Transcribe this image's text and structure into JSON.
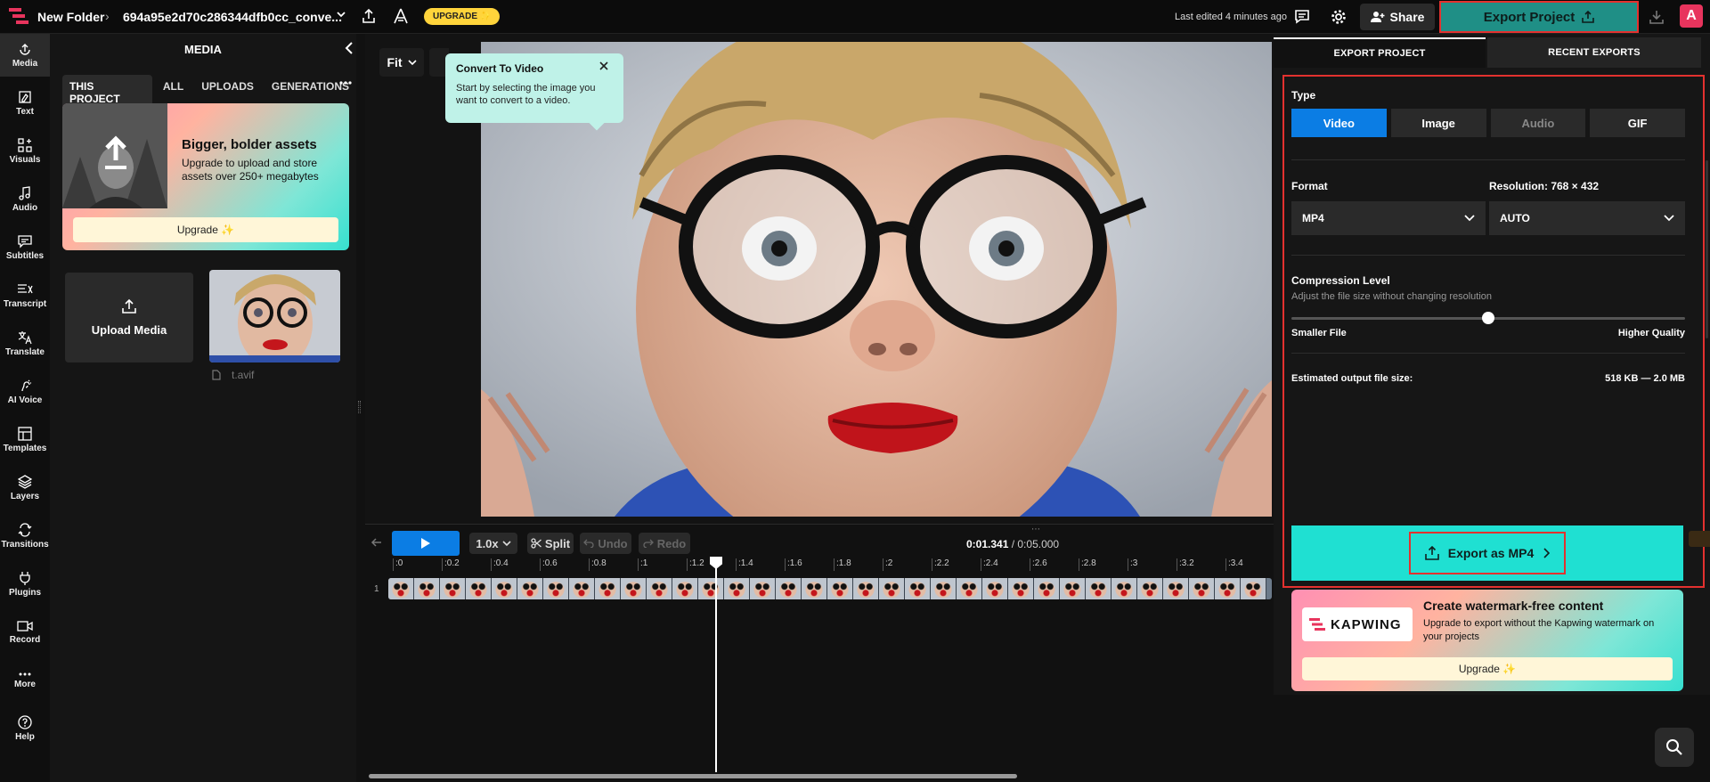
{
  "topbar": {
    "folder": "New Folder",
    "project_name": "694a95e2d70c286344dfb0cc_conve...",
    "upgrade_label": "UPGRADE ✨",
    "last_edited": "Last edited 4 minutes ago",
    "share_label": "Share",
    "export_label": "Export Project",
    "avatar_letter": "A"
  },
  "rail": [
    {
      "label": "Media",
      "icon": "media-icon"
    },
    {
      "label": "Text",
      "icon": "text-icon"
    },
    {
      "label": "Visuals",
      "icon": "visuals-icon"
    },
    {
      "label": "Audio",
      "icon": "audio-icon"
    },
    {
      "label": "Subtitles",
      "icon": "subtitles-icon"
    },
    {
      "label": "Transcript",
      "icon": "transcript-icon"
    },
    {
      "label": "Translate",
      "icon": "translate-icon"
    },
    {
      "label": "AI Voice",
      "icon": "ai-voice-icon"
    },
    {
      "label": "Templates",
      "icon": "templates-icon"
    },
    {
      "label": "Layers",
      "icon": "layers-icon"
    },
    {
      "label": "Transitions",
      "icon": "transitions-icon"
    },
    {
      "label": "Plugins",
      "icon": "plugins-icon"
    },
    {
      "label": "Record",
      "icon": "record-icon"
    },
    {
      "label": "More",
      "icon": "more-icon"
    },
    {
      "label": "Help",
      "icon": "help-icon"
    }
  ],
  "media": {
    "title": "MEDIA",
    "tabs": [
      "THIS PROJECT",
      "ALL",
      "UPLOADS",
      "GENERATIONS"
    ],
    "promo_title": "Bigger, bolder assets",
    "promo_text": "Upgrade to upload and store assets over 250+ megabytes",
    "promo_button": "Upgrade ✨",
    "upload_label": "Upload Media",
    "asset_name": "t.avif"
  },
  "canvas": {
    "fit_label": "Fit",
    "tooltip_title": "Convert To Video",
    "tooltip_text": "Start by selecting the image you want to convert to a video."
  },
  "timeline": {
    "speed": "1.0x",
    "split": "Split",
    "undo": "Undo",
    "redo": "Redo",
    "current_time": "0:01.341",
    "total_time": "/ 0:05.000",
    "track_number": "1",
    "ticks": [
      ":0",
      ":0.2",
      ":0.4",
      ":0.6",
      ":0.8",
      ":1",
      ":1.2",
      ":1.4",
      ":1.6",
      ":1.8",
      ":2",
      ":2.2",
      ":2.4",
      ":2.6",
      ":2.8",
      ":3",
      ":3.2",
      ":3.4"
    ]
  },
  "export": {
    "tab_export": "EXPORT PROJECT",
    "tab_recent": "RECENT EXPORTS",
    "type_label": "Type",
    "types": [
      "Video",
      "Image",
      "Audio",
      "GIF"
    ],
    "format_label": "Format",
    "format_value": "MP4",
    "resolution_label": "Resolution: 768 × 432",
    "resolution_value": "AUTO",
    "compression_label": "Compression Level",
    "compression_sub": "Adjust the file size without changing resolution",
    "compression_level": 0.5,
    "smaller": "Smaller File",
    "higher": "Higher Quality",
    "estimate_label": "Estimated output file size:",
    "estimate_value": "518 KB — 2.0 MB",
    "export_button": "Export as MP4",
    "wm_logo": "KAPWING",
    "wm_title": "Create watermark-free content",
    "wm_text": "Upgrade to export without the Kapwing watermark on your projects",
    "wm_button": "Upgrade ✨"
  },
  "colors": {
    "accent_blue": "#0b7de4",
    "export_teal": "#1fe0d2",
    "highlight_red": "#e3312f"
  }
}
